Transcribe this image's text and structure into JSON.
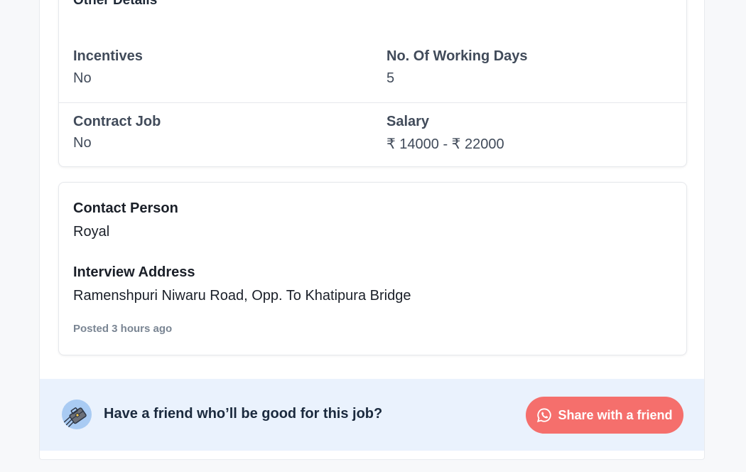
{
  "details": {
    "section_title": "Other Details",
    "items": [
      {
        "label": "Incentives",
        "value": "No"
      },
      {
        "label": "No. Of Working Days",
        "value": "5"
      },
      {
        "label": "Contract Job",
        "value": "No"
      },
      {
        "label": "Salary",
        "value": "₹ 14000 - ₹ 22000"
      }
    ]
  },
  "contact": {
    "person_label": "Contact Person",
    "person_value": "Royal",
    "address_label": "Interview Address",
    "address_value": "Ramenshpuri Niwaru Road, Opp. To Khatipura Bridge",
    "posted": "Posted 3 hours ago"
  },
  "share": {
    "prompt": "Have a friend who’ll be good for this job?",
    "button_label": "Share with a friend",
    "button_icon": "whatsapp-icon",
    "avatar_icon": "briefcase-icon",
    "button_color": "#f56f6c",
    "bar_color": "#eaf2fd"
  }
}
